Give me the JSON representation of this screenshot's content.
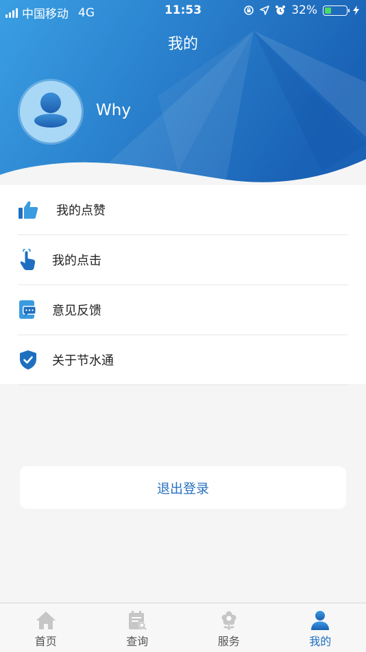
{
  "status_bar": {
    "carrier": "中国移动",
    "network": "4G",
    "time": "11:53",
    "battery": "32%",
    "battery_level": 0.32
  },
  "header": {
    "title": "我的",
    "username": "Why"
  },
  "menu": {
    "items": [
      {
        "label": "我的点赞",
        "icon": "thumbs-up-icon"
      },
      {
        "label": "我的点击",
        "icon": "tap-hand-icon"
      },
      {
        "label": "意见反馈",
        "icon": "feedback-icon"
      },
      {
        "label": "关于节水通",
        "icon": "shield-check-icon"
      }
    ]
  },
  "logout_label": "退出登录",
  "tabbar": {
    "items": [
      {
        "label": "首页",
        "icon": "home-icon"
      },
      {
        "label": "查询",
        "icon": "calendar-search-icon"
      },
      {
        "label": "服务",
        "icon": "flower-icon"
      },
      {
        "label": "我的",
        "icon": "person-icon"
      }
    ],
    "active_index": 3
  },
  "colors": {
    "header_gradient_start": "#3a9be0",
    "header_gradient_end": "#1a63b8",
    "accent": "#1e6fc0",
    "background": "#f5f5f5"
  }
}
